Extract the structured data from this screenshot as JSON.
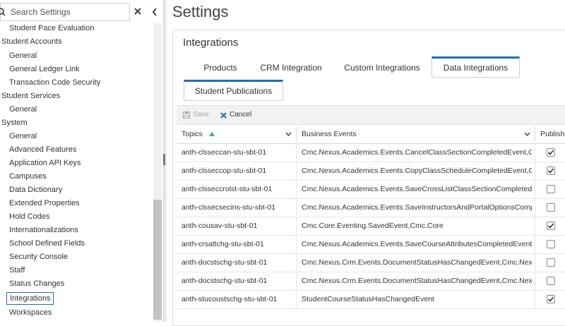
{
  "search": {
    "placeholder": "Search Settings",
    "value": ""
  },
  "sidebar": {
    "items": [
      {
        "label": "Student Pace Evaluation",
        "kind": "child"
      },
      {
        "label": "Student Accounts",
        "kind": "group"
      },
      {
        "label": "General",
        "kind": "child"
      },
      {
        "label": "General Ledger Link",
        "kind": "child"
      },
      {
        "label": "Transaction Code Security",
        "kind": "child"
      },
      {
        "label": "Student Services",
        "kind": "group"
      },
      {
        "label": "General",
        "kind": "child"
      },
      {
        "label": "System",
        "kind": "group"
      },
      {
        "label": "General",
        "kind": "child"
      },
      {
        "label": "Advanced Features",
        "kind": "child"
      },
      {
        "label": "Application API Keys",
        "kind": "child"
      },
      {
        "label": "Campuses",
        "kind": "child"
      },
      {
        "label": "Data Dictionary",
        "kind": "child"
      },
      {
        "label": "Extended Properties",
        "kind": "child"
      },
      {
        "label": "Hold Codes",
        "kind": "child"
      },
      {
        "label": "Internationalizations",
        "kind": "child"
      },
      {
        "label": "School Defined Fields",
        "kind": "child"
      },
      {
        "label": "Security Console",
        "kind": "child"
      },
      {
        "label": "Staff",
        "kind": "child"
      },
      {
        "label": "Status Changes",
        "kind": "child"
      },
      {
        "label": "Integrations",
        "kind": "selected"
      },
      {
        "label": "Workspaces",
        "kind": "child"
      }
    ]
  },
  "page": {
    "title": "Settings"
  },
  "panel": {
    "title": "Integrations",
    "tabs": [
      {
        "label": "Products"
      },
      {
        "label": "CRM Integration"
      },
      {
        "label": "Custom Integrations"
      },
      {
        "label": "Data Integrations",
        "active": true
      },
      {
        "label": "Student Publications"
      }
    ]
  },
  "toolbar": {
    "save_label": "Save",
    "cancel_label": "Cancel"
  },
  "grid": {
    "columns": [
      "Topics",
      "Business Events",
      "Publish"
    ],
    "rows": [
      {
        "topic": "anth-clsseccan-stu-sbt-01",
        "event": "Cmc.Nexus.Academics.Events.CancelClassSectionCompletedEvent,Cmc....",
        "publish": true
      },
      {
        "topic": "anth-clsseccop-stu-sbt-01",
        "event": "Cmc.Nexus.Academics.Events.CopyClassScheduleCompletedEvent,Cmc....",
        "publish": true
      },
      {
        "topic": "anth-clsseccrolst-stu-sbt-01",
        "event": "Cmc.Nexus.Academics.Events.SaveCrossListClassSectionCompletedEve...",
        "publish": false
      },
      {
        "topic": "anth-clssecsecins-stu-sbt-01",
        "event": "Cmc.Nexus.Academics.Events.SaveInstructorsAndPortalOptionsCompl...",
        "publish": false
      },
      {
        "topic": "anth-cousav-stu-sbt-01",
        "event": "Cmc.Core.Eventing.SavedEvent,Cmc.Core",
        "publish": true
      },
      {
        "topic": "anth-crsattchg-stu-sbt-01",
        "event": "Cmc.Nexus.Academics.Events.SaveCourseAttributesCompletedEvent,C...",
        "publish": false
      },
      {
        "topic": "anth-docstschg-stu-sbt-01",
        "event": "Cmc.Nexus.Crm.Events.DocumentStatusHasChangedEvent,Cmc.Nexus....",
        "publish": false
      },
      {
        "topic": "anth-docstschg-stu-sbt-01",
        "event": "Cmc.Nexus.Crm.Events.DocumentStatusHasChangedEvent,Cmc.Nexus....",
        "publish": false
      },
      {
        "topic": "anth-stucoustschg-stu-sbt-01",
        "event": "StudentCourseStatusHasChangedEvent",
        "publish": true
      }
    ]
  },
  "colors": {
    "accent": "#1f6fb5",
    "cancel_icon": "#1f6fb5"
  }
}
